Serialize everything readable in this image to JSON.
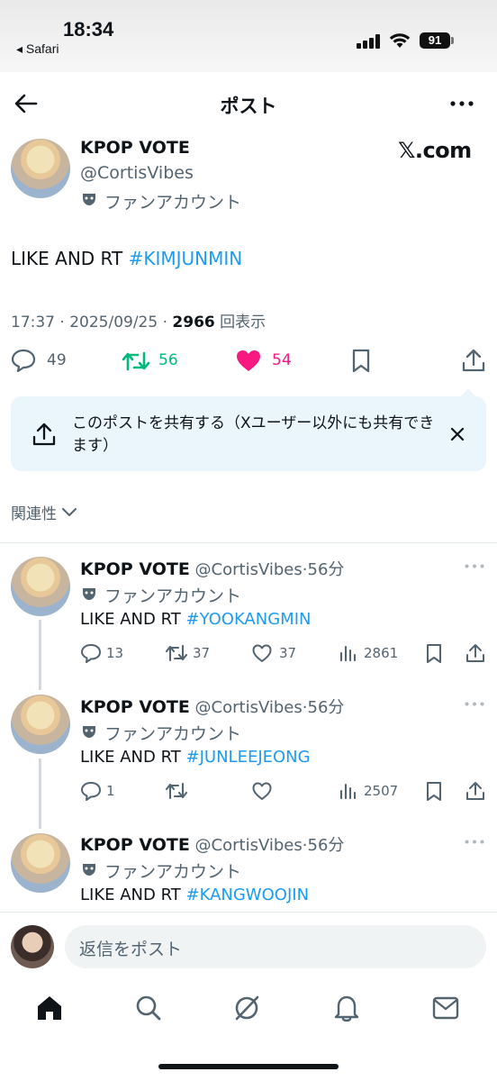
{
  "status_bar": {
    "time": "18:34",
    "back_app": "◂ Safari",
    "battery": "91",
    "icons": [
      "signal-icon",
      "wifi-icon",
      "battery-icon"
    ]
  },
  "header": {
    "title": "ポスト",
    "icons": [
      "back-arrow-icon",
      "more-icon"
    ]
  },
  "post": {
    "author_name": "KPOP VOTE",
    "author_handle": "@CortisVibes",
    "badge_label": "ファンアカウント",
    "brand": "𝕏.com",
    "text_prefix": "LIKE AND RT ",
    "hashtag": "#KIMJUNMIN",
    "timestamp": "17:37 · 2025/09/25 · ",
    "views_count": "2966",
    "views_label": " 回表示",
    "reply_count": "49",
    "retweet_count": "56",
    "like_count": "54",
    "colors": {
      "retweet": "#00ba7c",
      "like": "#f91880",
      "link": "#1d9bf0"
    }
  },
  "share_banner": {
    "text": "このポストを共有する（Xユーザー以外にも共有できます）"
  },
  "sort": {
    "label": "関連性"
  },
  "replies": [
    {
      "name": "KPOP VOTE",
      "handle": "@CortisVibes",
      "time": "·56分",
      "badge": "ファンアカウント",
      "text_prefix": "LIKE AND RT ",
      "hashtag": "#YOOKANGMIN",
      "replies": "13",
      "retweets": "37",
      "likes": "37",
      "views": "2861"
    },
    {
      "name": "KPOP VOTE",
      "handle": "@CortisVibes",
      "time": "·56分",
      "badge": "ファンアカウント",
      "text_prefix": "LIKE AND RT ",
      "hashtag": "#JUNLEEJEONG",
      "replies": "1",
      "retweets": "",
      "likes": "",
      "views": "2507"
    },
    {
      "name": "KPOP VOTE",
      "handle": "@CortisVibes",
      "time": "·56分",
      "badge": "ファンアカウント",
      "text_prefix": "LIKE AND RT ",
      "hashtag": "#KANGWOOJIN"
    }
  ],
  "compose": {
    "placeholder": "返信をポスト"
  },
  "tab_bar": {
    "tabs": [
      "home-icon",
      "search-icon",
      "grok-icon",
      "notifications-icon",
      "messages-icon"
    ]
  }
}
